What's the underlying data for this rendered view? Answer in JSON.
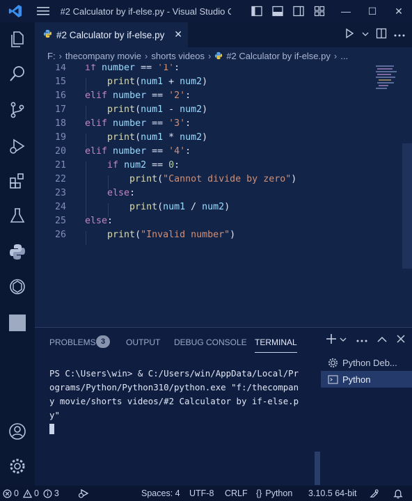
{
  "window": {
    "title": "#2 Calculator by if-else.py - Visual Studio C...",
    "controls": {
      "minimize": "—",
      "maximize": "☐",
      "close": "✕"
    }
  },
  "activity_bar": {
    "icons": [
      "explorer-icon",
      "search-icon",
      "source-control-icon",
      "run-debug-icon",
      "extensions-icon",
      "testing-icon",
      "python-icon",
      "openai-icon",
      "square-icon",
      "account-icon",
      "settings-icon"
    ]
  },
  "editor": {
    "tab": {
      "label": "#2 Calculator by if-else.py",
      "close": "✕"
    },
    "breadcrumb": [
      "F:",
      "thecompany movie",
      "shorts videos",
      "#2 Calculator by if-else.py",
      "..."
    ],
    "lines": [
      {
        "n": "14",
        "text": "if number == '1':"
      },
      {
        "n": "15",
        "text": "    print(num1 + num2)"
      },
      {
        "n": "16",
        "text": "elif number == '2':"
      },
      {
        "n": "17",
        "text": "    print(num1 - num2)"
      },
      {
        "n": "18",
        "text": "elif number == '3':"
      },
      {
        "n": "19",
        "text": "    print(num1 * num2)"
      },
      {
        "n": "20",
        "text": "elif number == '4':"
      },
      {
        "n": "21",
        "text": "    if num2 == 0:"
      },
      {
        "n": "22",
        "text": "        print(\"Cannot divide by zero\")"
      },
      {
        "n": "23",
        "text": "    else:"
      },
      {
        "n": "24",
        "text": "        print(num1 / num2)"
      },
      {
        "n": "25",
        "text": "else:"
      },
      {
        "n": "26",
        "text": "    print(\"Invalid number\")"
      }
    ]
  },
  "panel": {
    "tabs": {
      "problems": "PROBLEMS",
      "problems_count": "3",
      "output": "OUTPUT",
      "debug_console": "DEBUG CONSOLE",
      "terminal": "TERMINAL"
    },
    "terminal_lines": [
      "PS C:\\Users\\win> & C:/Users/win/AppData/Local/Pr",
      "ograms/Python/Python310/python.exe \"f:/thecompan",
      "y movie/shorts videos/#2 Calculator by if-else.p",
      "y\""
    ],
    "terminals": [
      "Python Deb...",
      "Python"
    ]
  },
  "status": {
    "errors": "0",
    "warnings": "0",
    "info": "3",
    "spaces": "Spaces: 4",
    "encoding": "UTF-8",
    "eol": "CRLF",
    "language": "Python",
    "interpreter": "3.10.5 64-bit"
  },
  "colors": {
    "keyword": "#c586c0",
    "string": "#ce9178",
    "function": "#dcdcaa",
    "variable": "#9cdcfe",
    "number": "#b5cea8",
    "operator": "#dfe6f7",
    "accent": "#3b8eea"
  }
}
